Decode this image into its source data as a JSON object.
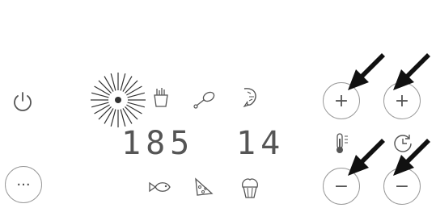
{
  "panel": {
    "temperature_display": "185",
    "time_display": "14"
  },
  "buttons": {
    "power_icon": "power-icon",
    "more_label": "···",
    "temp_up_label": "+",
    "time_up_label": "+",
    "temp_down_label": "−",
    "time_down_label": "−"
  },
  "presets": [
    "fries-icon",
    "drumstick-icon",
    "shrimp-icon",
    "fish-icon",
    "pizza-icon",
    "cupcake-icon"
  ],
  "indicators": {
    "active_preset": "light-burst-icon",
    "temperature_icon": "thermometer-icon",
    "timer_icon": "timer-icon"
  },
  "colors": {
    "icon_stroke": "#555555",
    "button_border": "#9a9a9a",
    "arrow": "#111111"
  }
}
